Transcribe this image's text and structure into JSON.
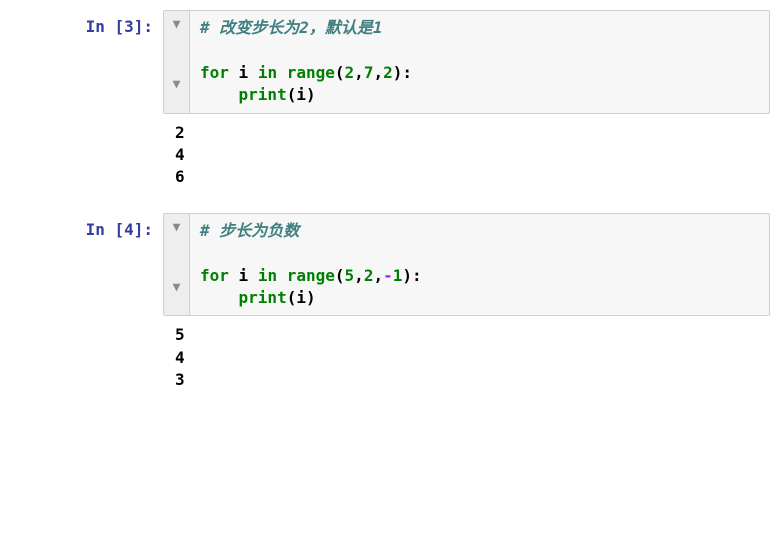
{
  "cells": [
    {
      "prompt_text": "In [3]:",
      "comment1": "# 改变步长为2，默认是1",
      "kw_for": "for",
      "var_i": " i ",
      "kw_in": "in",
      "sp1": " ",
      "fn_range": "range",
      "paren_open": "(",
      "arg1": "2",
      "comma1": ",",
      "arg2": "7",
      "comma2": ",",
      "arg3": "2",
      "paren_close_colon": "):",
      "indent": "    ",
      "fn_print": "print",
      "po2": "(",
      "var_i2": "i",
      "pc2": ")",
      "output": "2\n4\n6"
    },
    {
      "prompt_text": "In [4]:",
      "comment1": "# 步长为负数",
      "kw_for": "for",
      "var_i": " i ",
      "kw_in": "in",
      "sp1": " ",
      "fn_range": "range",
      "paren_open": "(",
      "arg1": "5",
      "comma1": ",",
      "arg2": "2",
      "comma2": ",",
      "arg3_neg": "-",
      "arg3_num": "1",
      "paren_close_colon": "):",
      "indent": "    ",
      "fn_print": "print",
      "po2": "(",
      "var_i2": "i",
      "pc2": ")",
      "output": "5\n4\n3"
    }
  ],
  "glyphs": {
    "fold": "▼"
  }
}
